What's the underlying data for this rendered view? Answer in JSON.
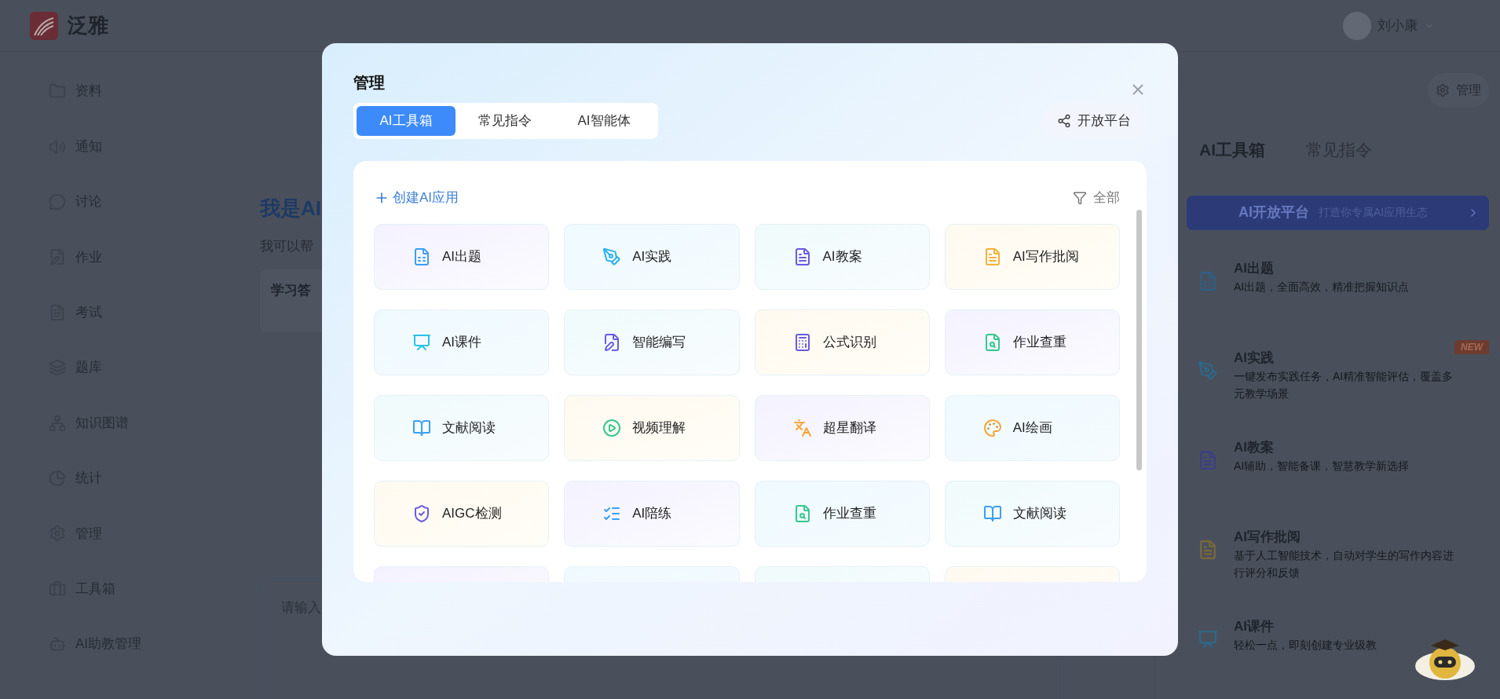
{
  "header": {
    "logo_text": "泛雅",
    "user_name": "刘小康"
  },
  "sidebar": {
    "items": [
      {
        "label": "资料"
      },
      {
        "label": "通知"
      },
      {
        "label": "讨论"
      },
      {
        "label": "作业"
      },
      {
        "label": "考试"
      },
      {
        "label": "题库"
      },
      {
        "label": "知识图谱"
      },
      {
        "label": "统计"
      },
      {
        "label": "管理"
      },
      {
        "label": "工具箱"
      },
      {
        "label": "AI助教管理"
      }
    ]
  },
  "main": {
    "greeting": "我是AI",
    "subtitle": "我可以帮",
    "card_title": "学习答",
    "input_placeholder": "请输入"
  },
  "right_panel": {
    "manage_button": "管理",
    "tabs": [
      {
        "label": "AI工具箱",
        "selected": true
      },
      {
        "label": "常见指令",
        "selected": false
      }
    ],
    "banner": {
      "title": "AI开放平台",
      "subtitle": "打造你专属AI应用生态"
    },
    "tools": [
      {
        "title": "AI出题",
        "description": "AI出题，全面高效，精准把握知识点"
      },
      {
        "title": "AI实践",
        "description": "一键发布实践任务，AI精准智能评估，覆盖多元教学场景",
        "badge": "NEW"
      },
      {
        "title": "AI教案",
        "description": "AI辅助，智能备课，智慧教学新选择"
      },
      {
        "title": "AI写作批阅",
        "description": "基于人工智能技术，自动对学生的写作内容进行评分和反馈"
      },
      {
        "title": "AI课件",
        "description": "轻松一点，即刻创建专业级教"
      }
    ]
  },
  "dialog": {
    "title": "管理",
    "tabs": [
      {
        "label": "AI工具箱",
        "selected": true
      },
      {
        "label": "常见指令",
        "selected": false
      },
      {
        "label": "AI智能体",
        "selected": false
      }
    ],
    "open_platform_button": "开放平台",
    "create_link": "创建AI应用",
    "filter": "全部",
    "apps": [
      {
        "label": "AI出题"
      },
      {
        "label": "AI实践"
      },
      {
        "label": "AI教案"
      },
      {
        "label": "AI写作批阅"
      },
      {
        "label": "AI课件"
      },
      {
        "label": "智能编写"
      },
      {
        "label": "公式识别"
      },
      {
        "label": "作业查重"
      },
      {
        "label": "文献阅读"
      },
      {
        "label": "视频理解"
      },
      {
        "label": "超星翻译"
      },
      {
        "label": "AI绘画"
      },
      {
        "label": "AIGC检测"
      },
      {
        "label": "AI陪练"
      },
      {
        "label": "作业查重"
      },
      {
        "label": "文献阅读"
      }
    ]
  }
}
